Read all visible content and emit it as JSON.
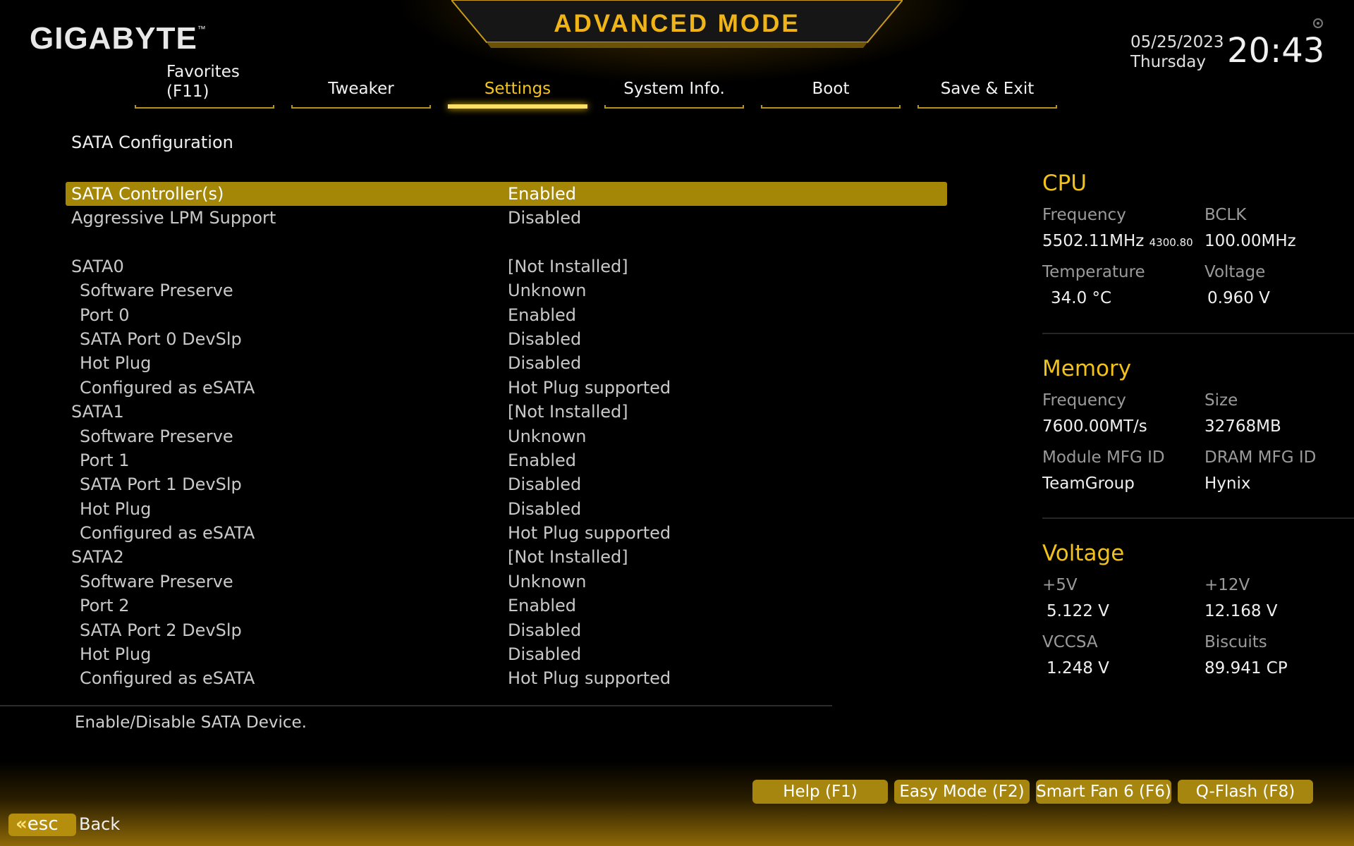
{
  "header": {
    "logo": "GIGABYTE",
    "logo_tm": "™",
    "mode_title": "ADVANCED MODE",
    "date": "05/25/2023",
    "day": "Thursday",
    "time": "20:43"
  },
  "tabs": [
    {
      "label_line1": "Favorites",
      "label_line2": "(F11)"
    },
    {
      "label": "Tweaker"
    },
    {
      "label": "Settings",
      "active": true
    },
    {
      "label": "System Info."
    },
    {
      "label": "Boot"
    },
    {
      "label": "Save & Exit"
    }
  ],
  "section_title": "SATA Configuration",
  "settings": [
    {
      "label": "SATA Controller(s)",
      "value": "Enabled"
    },
    {
      "label": "Aggressive LPM Support",
      "value": "Disabled"
    },
    {
      "label": "SATA0",
      "value": "[Not Installed]"
    },
    {
      "label": "Software Preserve",
      "value": "Unknown"
    },
    {
      "label": "Port 0",
      "value": "Enabled"
    },
    {
      "label": "SATA Port 0 DevSlp",
      "value": "Disabled"
    },
    {
      "label": "Hot Plug",
      "value": "Disabled"
    },
    {
      "label": "Configured as eSATA",
      "value": "Hot Plug supported"
    },
    {
      "label": "SATA1",
      "value": "[Not Installed]"
    },
    {
      "label": "Software Preserve",
      "value": "Unknown"
    },
    {
      "label": "Port 1",
      "value": "Enabled"
    },
    {
      "label": "SATA Port 1 DevSlp",
      "value": "Disabled"
    },
    {
      "label": "Hot Plug",
      "value": "Disabled"
    },
    {
      "label": "Configured as eSATA",
      "value": "Hot Plug supported"
    },
    {
      "label": "SATA2",
      "value": "[Not Installed]"
    },
    {
      "label": "Software Preserve",
      "value": "Unknown"
    },
    {
      "label": "Port 2",
      "value": "Enabled"
    },
    {
      "label": "SATA Port 2 DevSlp",
      "value": "Disabled"
    },
    {
      "label": "Hot Plug",
      "value": "Disabled"
    },
    {
      "label": "Configured as eSATA",
      "value": "Hot Plug supported"
    }
  ],
  "help_text": "Enable/Disable SATA Device.",
  "cpu": {
    "title": "CPU",
    "freq_label": "Frequency",
    "freq_value": "5502.11MHz",
    "freq_sub": "4300.80",
    "bclk_label": "BCLK",
    "bclk_value": "100.00MHz",
    "temp_label": "Temperature",
    "temp_value": "34.0 °C",
    "volt_label": "Voltage",
    "volt_value": "0.960 V"
  },
  "memory": {
    "title": "Memory",
    "freq_label": "Frequency",
    "freq_value": "7600.00MT/s",
    "size_label": "Size",
    "size_value": "32768MB",
    "module_label": "Module MFG ID",
    "module_value": "TeamGroup",
    "dram_label": "DRAM MFG ID",
    "dram_value": "Hynix"
  },
  "voltage": {
    "title": "Voltage",
    "v5_label": "+5V",
    "v5_value": "5.122 V",
    "v12_label": "+12V",
    "v12_value": "12.168 V",
    "vccsa_label": "VCCSA",
    "vccsa_value": "1.248 V",
    "biscuits_label": "Biscuits",
    "biscuits_value": "89.941 CP"
  },
  "footer": {
    "help_btn": "Help (F1)",
    "easy_btn": "Easy Mode (F2)",
    "fan_btn": "Smart Fan 6 (F6)",
    "qflash_btn": "Q-Flash (F8)",
    "esc_chevron": "«",
    "esc_label": "esc",
    "back_label": "Back"
  },
  "colors": {
    "accent": "#f2c21a",
    "selection": "#a58708",
    "button": "#a78610"
  }
}
